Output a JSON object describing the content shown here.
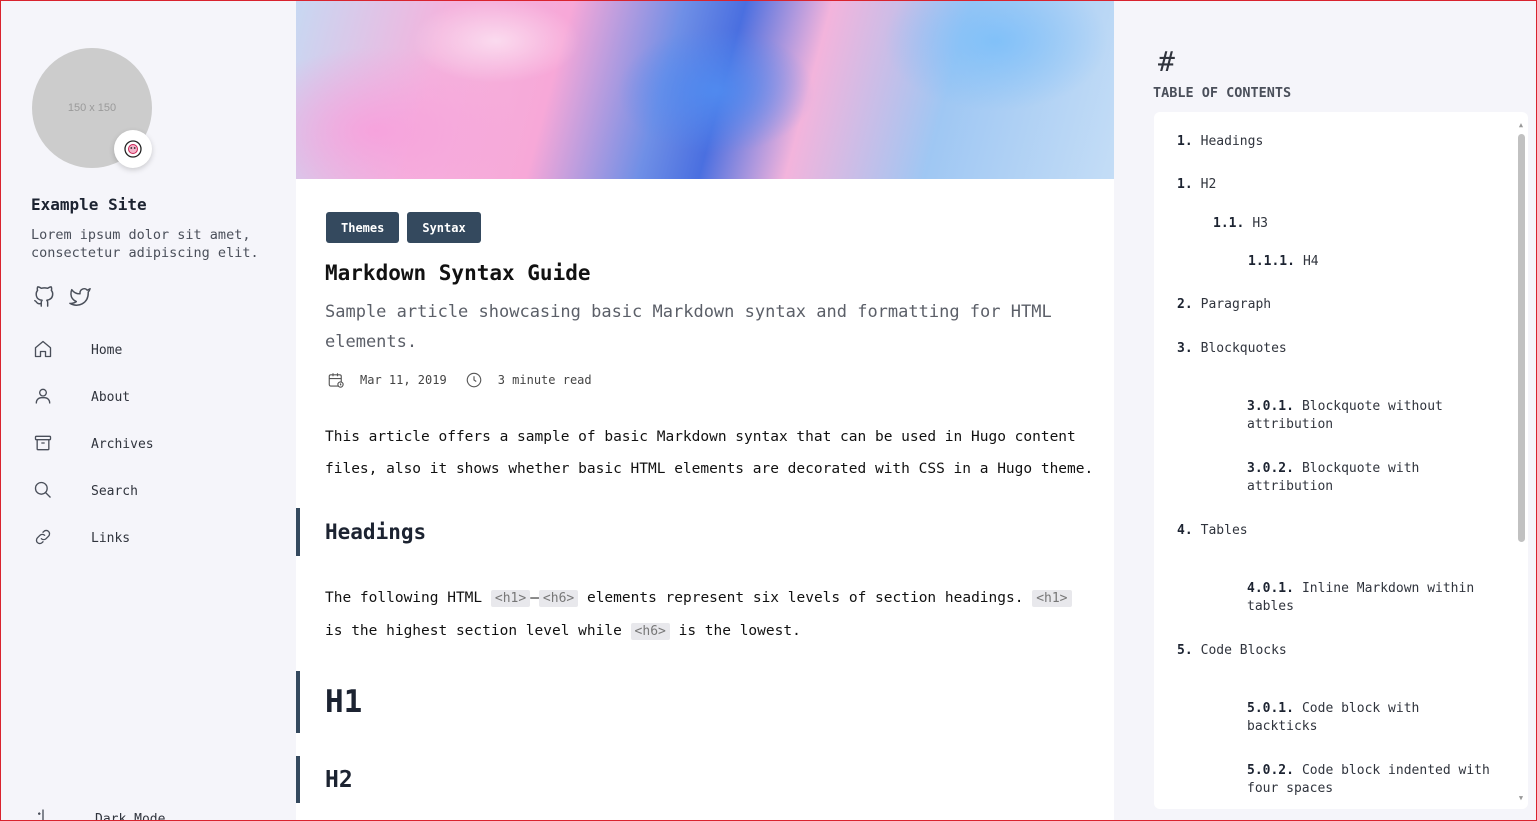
{
  "sidebar": {
    "avatar_placeholder": "150 x 150",
    "avatar_badge": "emoji-badge",
    "site_name": "Example Site",
    "site_description": "Lorem ipsum dolor sit amet, consectetur adipiscing elit.",
    "socials": [
      "github-icon",
      "twitter-icon"
    ],
    "menu": [
      {
        "label": "Home",
        "icon": "home-icon"
      },
      {
        "label": "About",
        "icon": "user-icon"
      },
      {
        "label": "Archives",
        "icon": "archive-icon"
      },
      {
        "label": "Search",
        "icon": "search-icon"
      },
      {
        "label": "Links",
        "icon": "link-icon"
      }
    ],
    "dark_mode_label": "Dark Mode"
  },
  "article": {
    "tags": [
      "Themes",
      "Syntax"
    ],
    "title": "Markdown Syntax Guide",
    "subtitle": "Sample article showcasing basic Markdown syntax and formatting for HTML elements.",
    "date": "Mar 11, 2019",
    "read_time": "3 minute read",
    "intro": "This article offers a sample of basic Markdown syntax that can be used in Hugo content files, also it shows whether basic HTML elements are decorated with CSS in a Hugo theme.",
    "section_heading": "Headings",
    "para_part1": "The following HTML",
    "code_h1": "<h1>",
    "dash": "—",
    "code_h6": "<h6>",
    "para_part2": "elements represent six levels of section headings.",
    "code_h1b": "<h1>",
    "para_part3": "is the highest section level while",
    "code_h6b": "<h6>",
    "para_part4": "is the lowest.",
    "h1_text": "H1",
    "h2_text": "H2"
  },
  "toc": {
    "hash": "#",
    "title": "TABLE OF CONTENTS",
    "items": [
      {
        "num": "1.",
        "label": "Headings"
      },
      {
        "num": "1.",
        "label": "H2"
      },
      {
        "num": "1.1.",
        "label": "H3"
      },
      {
        "num": "1.1.1.",
        "label": "H4"
      },
      {
        "num": "2.",
        "label": "Paragraph"
      },
      {
        "num": "3.",
        "label": "Blockquotes"
      },
      {
        "num": "3.0.1.",
        "label": "Blockquote without attribution"
      },
      {
        "num": "3.0.2.",
        "label": "Blockquote with attribution"
      },
      {
        "num": "4.",
        "label": "Tables"
      },
      {
        "num": "4.0.1.",
        "label": "Inline Markdown within tables"
      },
      {
        "num": "5.",
        "label": "Code Blocks"
      },
      {
        "num": "5.0.1.",
        "label": "Code block with backticks"
      },
      {
        "num": "5.0.2.",
        "label": "Code block indented with four spaces"
      }
    ]
  },
  "colors": {
    "tag_bg": "#34495e",
    "sidebar_bg": "#f5f5fa",
    "accent_border": "#34495e"
  }
}
